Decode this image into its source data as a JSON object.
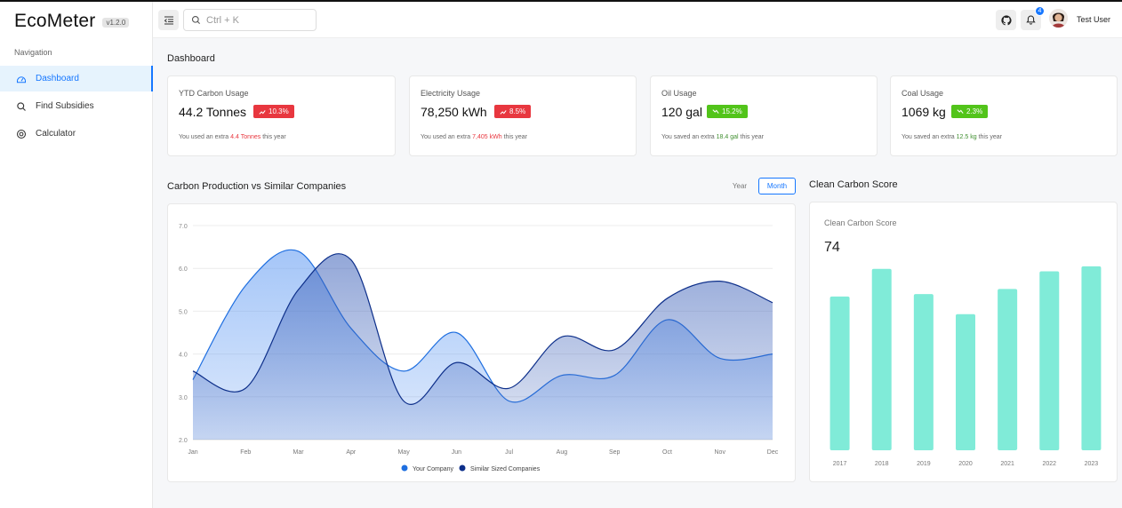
{
  "app": {
    "name": "EcoMeter",
    "version": "v1.2.0"
  },
  "sidebar": {
    "heading": "Navigation",
    "items": [
      {
        "label": "Dashboard",
        "icon": "dashboard-icon",
        "active": true
      },
      {
        "label": "Find Subsidies",
        "icon": "search-icon",
        "active": false
      },
      {
        "label": "Calculator",
        "icon": "calculator-icon",
        "active": false
      }
    ]
  },
  "header": {
    "search_placeholder": "Ctrl + K",
    "notifications_count": "4",
    "user_name": "Test User"
  },
  "page": {
    "title": "Dashboard"
  },
  "stats": [
    {
      "label": "YTD Carbon Usage",
      "value": "44.2 Tonnes",
      "change": "10.3%",
      "trend": "up",
      "note_prefix": "You used an extra",
      "note_highlight": "4.4 Tonnes",
      "note_suffix": "this year"
    },
    {
      "label": "Electricity Usage",
      "value": "78,250 kWh",
      "change": "8.5%",
      "trend": "up",
      "note_prefix": "You used an extra",
      "note_highlight": "7,405 kWh",
      "note_suffix": "this year"
    },
    {
      "label": "Oil Usage",
      "value": "120 gal",
      "change": "15.2%",
      "trend": "down",
      "note_prefix": "You saved an extra",
      "note_highlight": "18.4 gal",
      "note_suffix": "this year"
    },
    {
      "label": "Coal Usage",
      "value": "1069 kg",
      "change": "2.3%",
      "trend": "down",
      "note_prefix": "You saved an extra",
      "note_highlight": "12.5 kg",
      "note_suffix": "this year"
    }
  ],
  "carbon_section": {
    "title": "Carbon Production vs Similar Companies",
    "toggle_year": "Year",
    "toggle_month": "Month"
  },
  "score_section": {
    "title": "Clean Carbon Score",
    "card_label": "Clean Carbon Score",
    "score": "74"
  },
  "colors": {
    "accent": "#1677ff",
    "series1": "#1f6fe0",
    "series2": "#0d2f8a",
    "bar": "#80ebd8",
    "up": "#e8373f",
    "down": "#52c41a"
  },
  "chart_data": [
    {
      "type": "area",
      "categories": [
        "Jan",
        "Feb",
        "Mar",
        "Apr",
        "May",
        "Jun",
        "Jul",
        "Aug",
        "Sep",
        "Oct",
        "Nov",
        "Dec"
      ],
      "series": [
        {
          "name": "Your Company",
          "values": [
            3.4,
            5.6,
            6.4,
            4.6,
            3.6,
            4.5,
            2.9,
            3.5,
            3.5,
            4.8,
            3.9,
            4.0
          ]
        },
        {
          "name": "Similar Sized Companies",
          "values": [
            3.6,
            3.2,
            5.5,
            6.2,
            2.9,
            3.8,
            3.2,
            4.4,
            4.1,
            5.3,
            5.7,
            5.2
          ]
        }
      ],
      "ylim": [
        2.0,
        7.0
      ],
      "yticks": [
        "2.0",
        "3.0",
        "4.0",
        "5.0",
        "6.0",
        "7.0"
      ],
      "grid": true,
      "legend": "bottom-center"
    },
    {
      "type": "bar",
      "categories": [
        "2017",
        "2018",
        "2019",
        "2020",
        "2021",
        "2022",
        "2023"
      ],
      "values": [
        61,
        72,
        62,
        54,
        64,
        71,
        73
      ],
      "ylim": [
        0,
        80
      ],
      "grid": false
    }
  ]
}
